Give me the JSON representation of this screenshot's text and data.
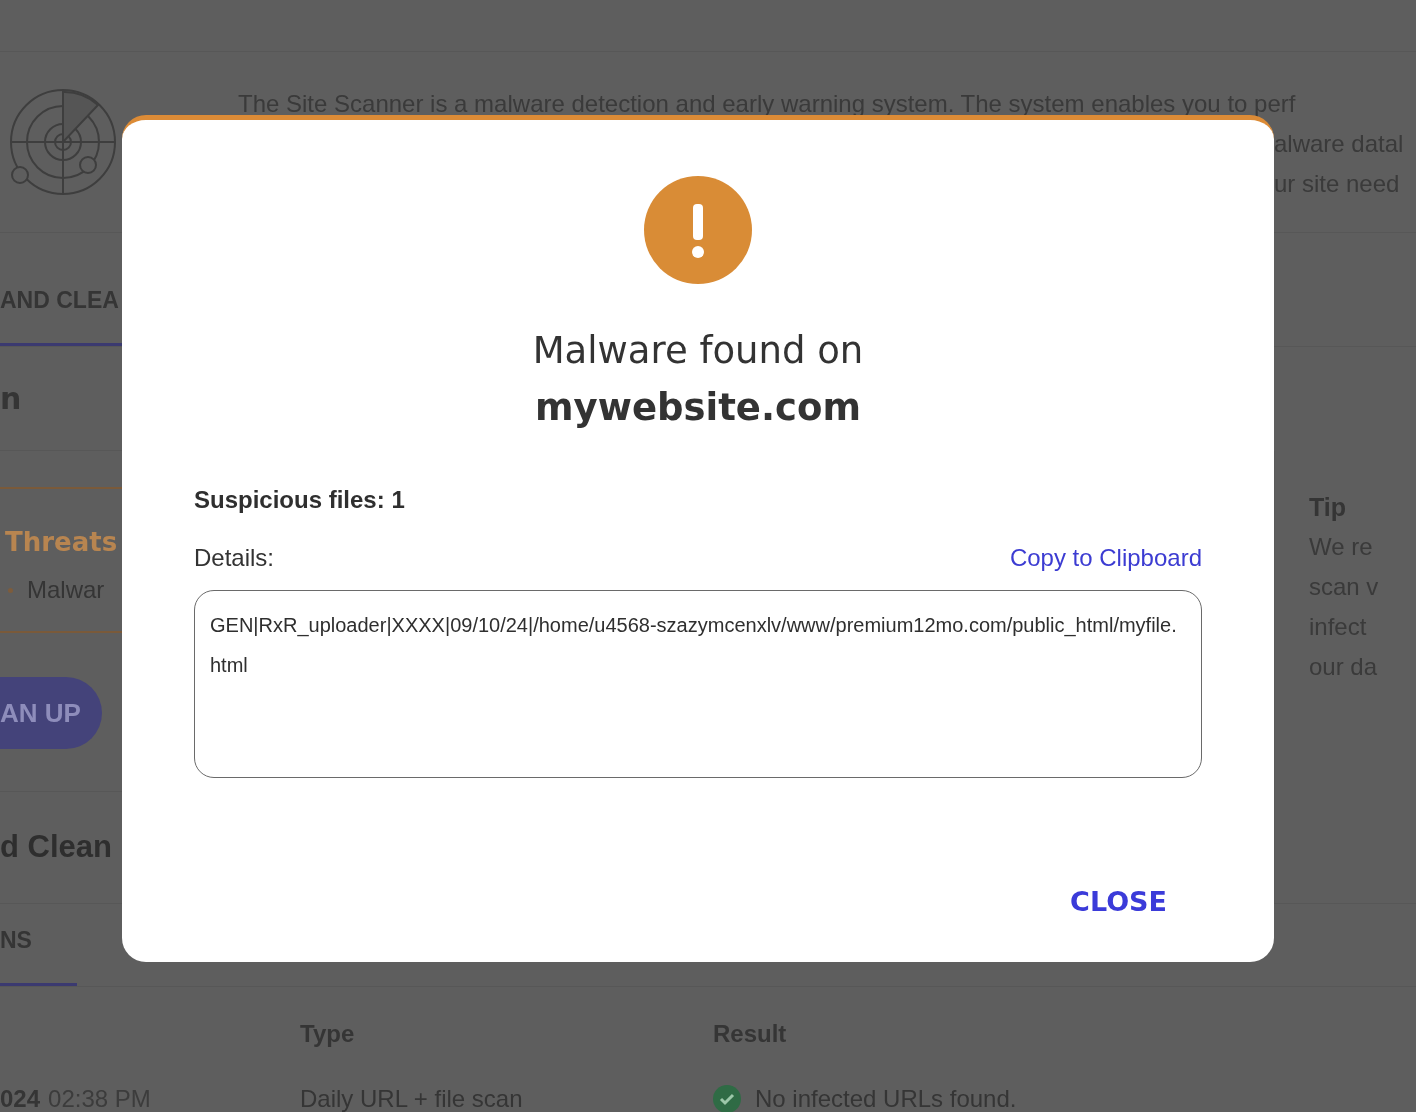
{
  "page": {
    "intro_lines": [
      "The Site Scanner is a malware detection and early warning system. The system enables you to perf",
      "alware datal",
      "ur site need"
    ],
    "tabs": [
      {
        "label": "AND CLEA",
        "selected": true
      }
    ],
    "section_heading": "n",
    "threats": {
      "title": "Threats",
      "items": [
        "Malwar"
      ]
    },
    "cleanup_button": "AN UP",
    "cleanup_heading": "d Clean",
    "history_tabs": [
      {
        "label": "NS",
        "selected": true
      }
    ],
    "table": {
      "columns": [
        "Type",
        "Result"
      ],
      "rows": [
        {
          "date": "024",
          "time": "02:38 PM",
          "type": "Daily URL + file scan",
          "passed": true,
          "result": "No infected URLs found."
        }
      ]
    },
    "tip": {
      "title": "Tip",
      "lines": [
        "We re",
        "scan v",
        "infect",
        "our da"
      ]
    }
  },
  "dialog": {
    "title": "Malware found on",
    "site": "mywebsite.com",
    "suspicious": "Suspicious files: 1",
    "details_label": "Details:",
    "copy_link": "Copy to Clipboard",
    "details": "GEN|RxR_uploader|XXXX|09/10/24|/home/u4568-szazymcenxlv/www/premium12mo.com/public_html/myfile.html",
    "close": "CLOSE"
  }
}
